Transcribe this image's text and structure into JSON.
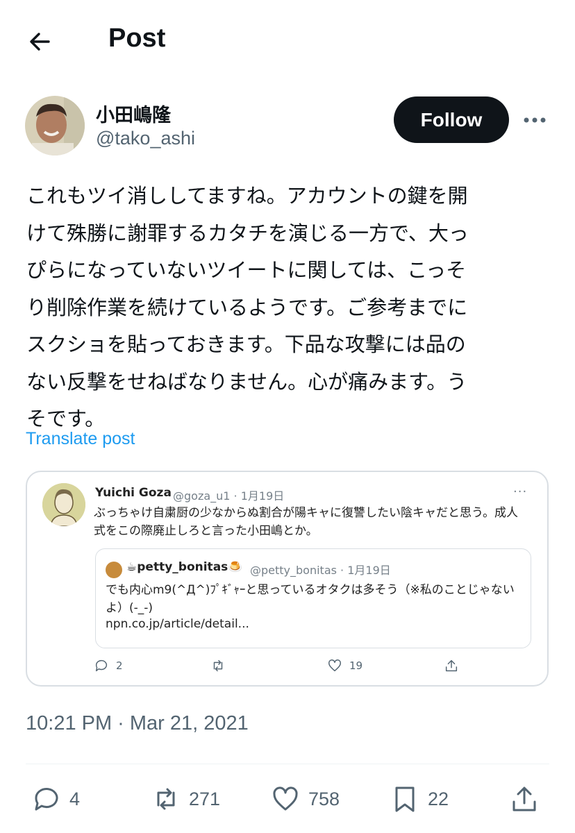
{
  "header": {
    "title": "Post"
  },
  "author": {
    "name": "小田嶋隆",
    "handle": "@tako_ashi",
    "follow_label": "Follow"
  },
  "post": {
    "lines": [
      "これもツイ消ししてますね。アカウントの鍵を開",
      "けて殊勝に謝罪するカタチを演じる一方で、大っ",
      "ぴらになっていないツイートに関しては、こっそ",
      "り削除作業を続けているようです。ご参考までに",
      "スクショを貼っておきます。下品な攻撃には品の",
      "ない反撃をせねばなりません。心が痛みます。う",
      "そです。"
    ],
    "translate_label": "Translate post",
    "timestamp": "10:21 PM · Mar 21, 2021"
  },
  "quoted_screenshot": {
    "name": "Yuichi Goza",
    "handle_date": "@goza_u1 · 1月19日",
    "more": "···",
    "text_lines": [
      "ぶっちゃけ自粛厨の少なからぬ割合が陽キャに復讐したい陰キャだと思う。成人",
      "式をこの際廃止しろと言った小田嶋とか。"
    ],
    "nested": {
      "name": "petty_bonitas",
      "handle_date": "@petty_bonitas · 1月19日",
      "text_lines": [
        "でも内心m9(^Д^)ﾌﾟｷﾞｬｰと思っているオタクは多そう（※私のことじゃない",
        "よ）(-_-)"
      ],
      "link": "npn.co.jp/article/detail..."
    },
    "stats": {
      "replies": "2",
      "likes": "19"
    }
  },
  "actions": {
    "replies": "4",
    "reposts": "271",
    "likes": "758",
    "bookmarks": "22"
  }
}
